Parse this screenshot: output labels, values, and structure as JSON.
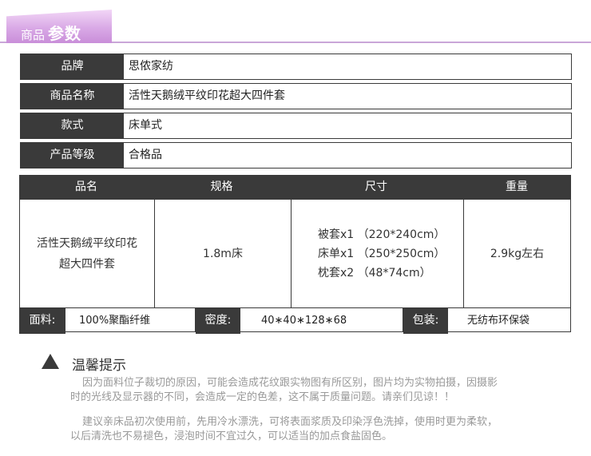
{
  "header": {
    "small_label": "商品",
    "big_label": "参数"
  },
  "params": [
    {
      "label": "品牌",
      "value": "思侬家纺"
    },
    {
      "label": "商品名称",
      "value": "活性天鹅绒平纹印花超大四件套"
    },
    {
      "label": "款式",
      "value": "床单式"
    },
    {
      "label": "产品等级",
      "value": "合格品"
    }
  ],
  "spec": {
    "headers": [
      "品名",
      "规格",
      "尺寸",
      "重量"
    ],
    "name_lines": [
      "活性天鹅绒平纹印花",
      "超大四件套"
    ],
    "spec_value": "1.8m床",
    "sizes": [
      "被套x1 （220*240cm）",
      "床单x1 （250*250cm）",
      "枕套x2 （48*74cm）"
    ],
    "weight": "2.9kg左右",
    "footer": {
      "fabric_label": "面料:",
      "fabric_value": "100%聚酯纤维",
      "density_label": "密度:",
      "density_value": "40∗40∗128∗68",
      "package_label": "包装:",
      "package_value": "无纺布环保袋"
    }
  },
  "tips": {
    "title": "温馨提示",
    "para1": [
      "因为面料位子裁切的原因，可能会造成花纹跟实物图有所区别，图片均为实物拍摄，因摄影",
      "时的光线及显示器的不同，会造成一定的色差，这不属于质量问题。请亲们见谅！！"
    ],
    "para2": [
      "建议亲床品初次使用前，先用冷水漂洗，可将表面浆质及印染浮色洗掉，使用时更为柔软，",
      "以后清洗也不易褪色，浸泡时间不宜过久，可以适当的加点食盐固色。"
    ]
  }
}
